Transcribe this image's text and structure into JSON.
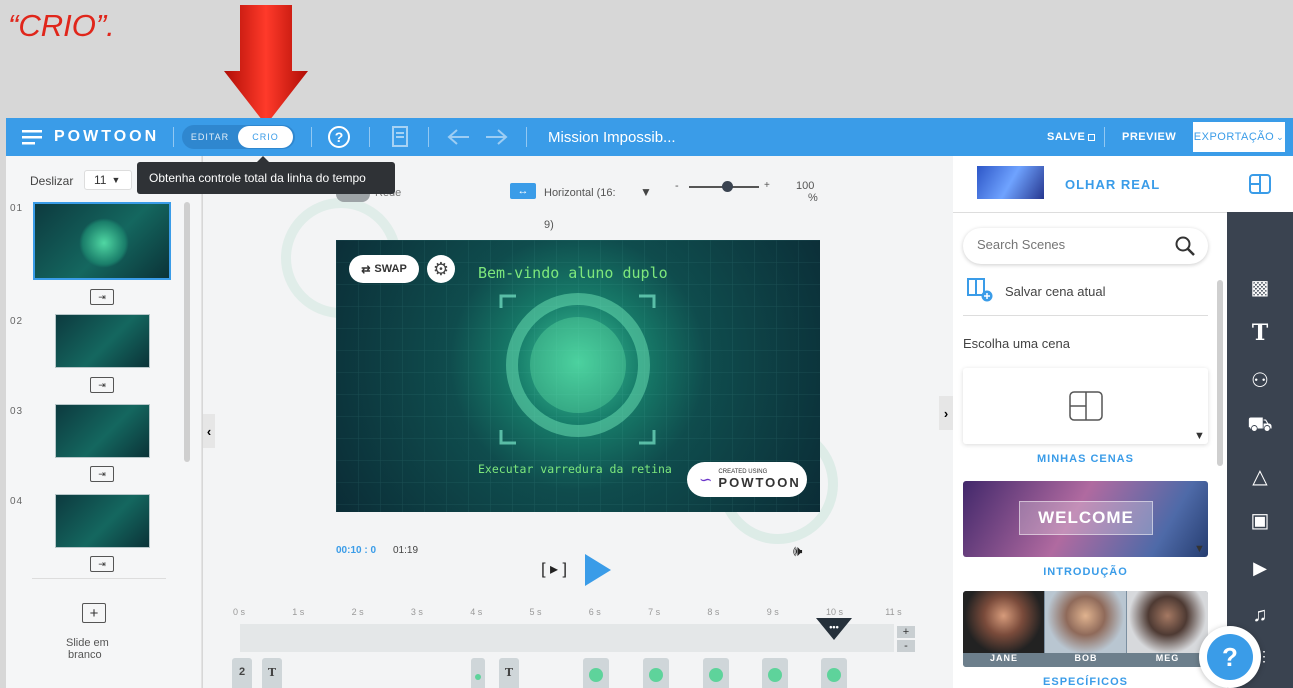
{
  "caption": "“CRIO”.",
  "topbar": {
    "logo": "POWTOON",
    "mode_edit": "EDITAR",
    "mode_create": "CRIO",
    "help_glyph": "?",
    "project_title": "Mission Impossib...",
    "save": "SALVE",
    "preview": "PREVIEW",
    "export": "EXPORTAÇÃO"
  },
  "tooltip": "Obtenha controle total da linha do tempo",
  "left": {
    "scroll_label": "Deslizar",
    "scroll_value": "11",
    "slides": [
      "01",
      "02",
      "03",
      "04"
    ],
    "blank_slide_line1": "Slide em",
    "blank_slide_line2": "branco"
  },
  "canvas": {
    "grid_label": "Rede",
    "orientation": "Horizontal (16:",
    "orientation_cont": "9)",
    "zoom_minus": "-",
    "zoom_plus": "+",
    "zoom_value": "100",
    "zoom_unit": "%",
    "zoom_level": 0.55,
    "swap": "SWAP",
    "title_text": "Bem-vindo aluno duplo",
    "subtitle_text": "Executar varredura da retina",
    "badge_small": "CREATED USING",
    "badge_big": "POWTOON",
    "time_current": "00:10 : 0",
    "time_total": "01:19"
  },
  "timeline": {
    "ticks": [
      "0 s",
      "1 s",
      "2 s",
      "3 s",
      "4 s",
      "5 s",
      "6 s",
      "7 s",
      "8 s",
      "9 s",
      "10 s",
      "11 s"
    ],
    "playhead_glyph": "•••",
    "item_2": "2",
    "item_t": "T",
    "plus": "+",
    "minus": "-"
  },
  "right": {
    "header": "OLHAR REAL",
    "search_placeholder": "Search Scenes",
    "save_scene": "Salvar cena atual",
    "choose_scene": "Escolha uma cena",
    "card_my_scenes": "MINHAS CENAS",
    "card_intro_image_text": "WELCOME",
    "card_intro": "INTRODUÇÃO",
    "people": [
      "JANE",
      "BOB",
      "MEG"
    ],
    "card_specific": "ESPECÍFICOS"
  },
  "colors": {
    "accent": "#3a9ce8",
    "arrow": "#e0261b",
    "caption": "#e0261b",
    "sidebar": "#3a4350",
    "play": "#3a9ce8"
  }
}
